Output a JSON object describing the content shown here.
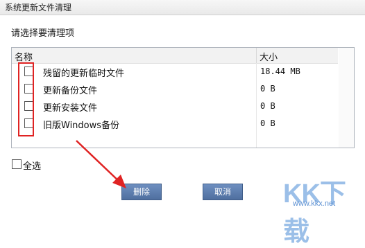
{
  "window": {
    "title": "系统更新文件清理"
  },
  "prompt": "请选择要清理项",
  "table": {
    "columns": [
      "名称",
      "大小"
    ],
    "rows": [
      {
        "name": "残留的更新临时文件",
        "size": "18.44 MB",
        "checked": false
      },
      {
        "name": "更新备份文件",
        "size": "0 B",
        "checked": false
      },
      {
        "name": "更新安装文件",
        "size": "0 B",
        "checked": false
      },
      {
        "name": "旧版Windows备份",
        "size": "0 B",
        "checked": false
      }
    ]
  },
  "select_all": {
    "label": "全选",
    "checked": false
  },
  "buttons": {
    "delete": "删除",
    "cancel": "取消"
  },
  "annotation": {
    "highlight_color": "#e02323",
    "arrow_color": "#e02323"
  },
  "watermark": {
    "logo": "KK下载",
    "url": "www.kkx.net"
  }
}
